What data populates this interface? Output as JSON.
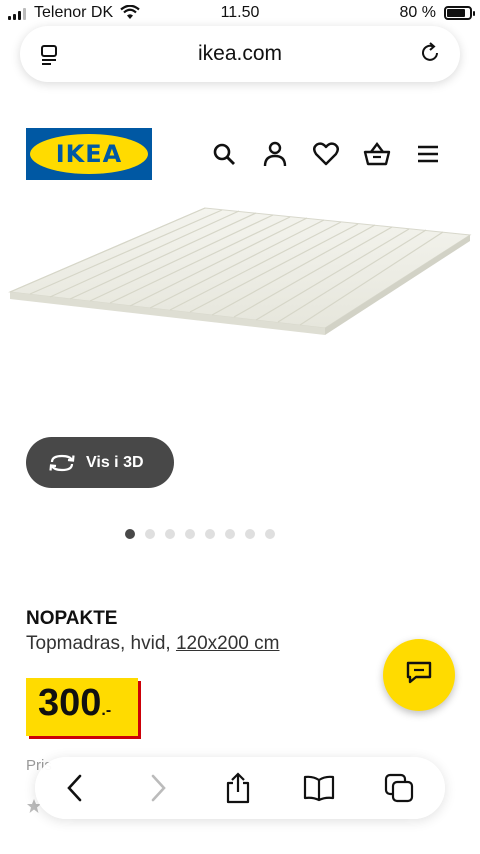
{
  "status_bar": {
    "carrier": "Telenor DK",
    "time": "11.50",
    "battery": "80 %",
    "battery_level": 0.8
  },
  "browser": {
    "url": "ikea.com"
  },
  "header": {
    "logo_text": "IKEA",
    "brand_colors": {
      "blue": "#0058a3",
      "yellow": "#ffdb00"
    },
    "icons": [
      "search-icon",
      "profile-icon",
      "heart-icon",
      "basket-icon",
      "menu-icon"
    ]
  },
  "gallery": {
    "view_3d_label": "Vis i 3D",
    "image_count": 8,
    "active_index": 0
  },
  "product": {
    "name": "NOPAKTE",
    "description": "Topmadras, hvid, ",
    "size": "120x200 cm",
    "price": "300",
    "price_suffix": ".-",
    "price_tag_color": "#ffdb00",
    "price_shadow_color": "#cc0008"
  },
  "below_fold": {
    "faded_text": "Pris",
    "rating_icon": "star-icon"
  },
  "toolbar": {
    "icons": [
      "back-icon",
      "forward-icon",
      "share-icon",
      "bookmarks-icon",
      "tabs-icon"
    ]
  }
}
